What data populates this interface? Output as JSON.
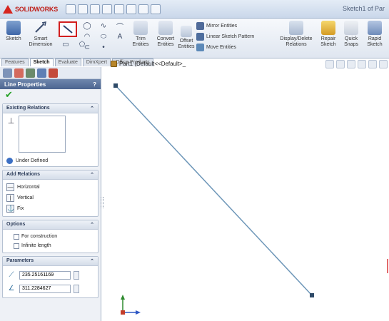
{
  "app": {
    "brand": "SOLIDWORKS",
    "window_title": "Sketch1 of Par"
  },
  "ribbon": {
    "sketch_label": "Sketch",
    "smart_dimension_label": "Smart Dimension",
    "trim_label": "Trim Entities",
    "convert_label": "Convert Entities",
    "offset_label": "Offset Entities",
    "mirror_label": "Mirror Entities",
    "linear_pattern_label": "Linear Sketch Pattern",
    "move_label": "Move Entities",
    "display_relations_label": "Display/Delete Relations",
    "repair_label": "Repair Sketch",
    "quick_snaps_label": "Quick Snaps",
    "rapid_sketch_label": "Rapid Sketch"
  },
  "tabs": [
    "Features",
    "Sketch",
    "Evaluate",
    "DimXpert",
    "Office Products"
  ],
  "tree": {
    "part_label": "Part1 (Default<<Default>_"
  },
  "property_manager": {
    "title": "Line Properties",
    "ok_symbol": "✔",
    "existing_relations": {
      "header": "Existing Relations",
      "status": "Under Defined"
    },
    "add_relations": {
      "header": "Add Relations",
      "items": [
        "Horizontal",
        "Vertical",
        "Fix"
      ]
    },
    "options": {
      "header": "Options",
      "items": [
        "For construction",
        "Infinite length"
      ]
    },
    "parameters": {
      "header": "Parameters",
      "length_value": "235.25161169",
      "angle_value": "311.2284627"
    }
  },
  "colors": {
    "sketch_line": "#6d96b8",
    "highlight": "#d21f1f",
    "panel_header": "#4c6590"
  }
}
